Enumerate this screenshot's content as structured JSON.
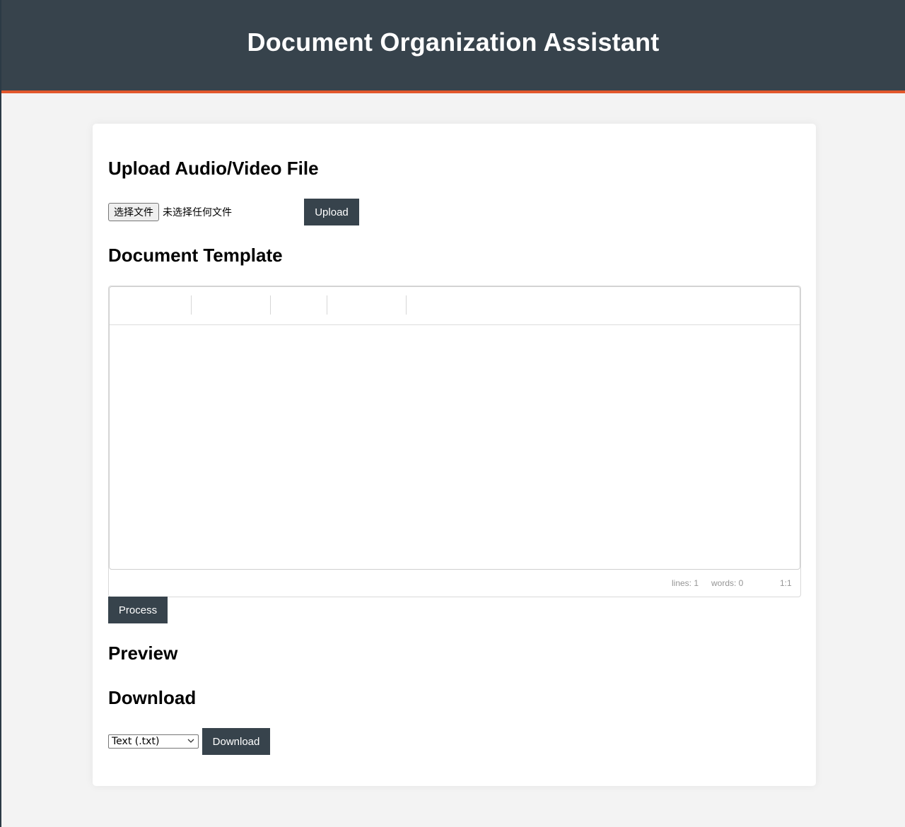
{
  "header": {
    "title": "Document Organization Assistant"
  },
  "upload": {
    "title": "Upload Audio/Video File",
    "choose_file_label": "选择文件",
    "no_file_label": "未选择任何文件",
    "upload_button": "Upload"
  },
  "template": {
    "title": "Document Template",
    "status": {
      "lines": "lines: 1",
      "words": "words: 0",
      "cursor": "1:1"
    },
    "process_button": "Process"
  },
  "preview": {
    "title": "Preview"
  },
  "download": {
    "title": "Download",
    "format_selected": "Text (.txt)",
    "download_button": "Download"
  },
  "colors": {
    "header_bg": "#37434c",
    "header_accent": "#e2572c",
    "button_bg": "#37434c"
  }
}
